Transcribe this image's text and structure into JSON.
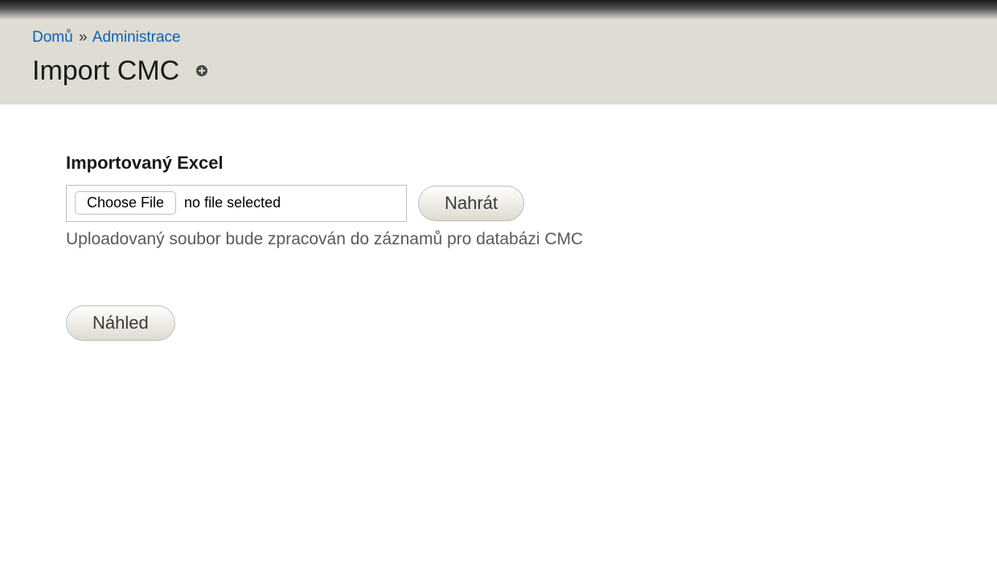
{
  "breadcrumb": {
    "home": "Domů",
    "separator": "»",
    "admin": "Administrace"
  },
  "header": {
    "title": "Import CMC",
    "plus_icon": "plus-circle"
  },
  "form": {
    "field_label": "Importovaný Excel",
    "choose_file_label": "Choose File",
    "no_file_text": "no file selected",
    "upload_button": "Nahrát",
    "description": "Uploadovaný soubor bude zpracován do záznamů pro databázi CMC",
    "preview_button": "Náhled"
  }
}
